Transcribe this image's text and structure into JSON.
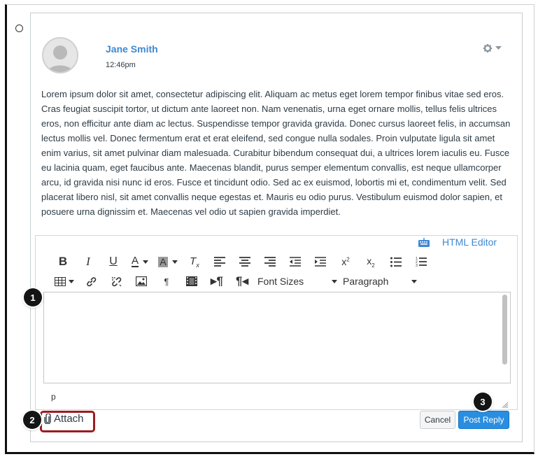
{
  "post": {
    "author": "Jane Smith",
    "time": "12:46pm",
    "body": "Lorem ipsum dolor sit amet, consectetur adipiscing elit. Aliquam ac metus eget lorem tempor finibus vitae sed eros. Cras feugiat suscipit tortor, ut dictum ante laoreet non. Nam venenatis, urna eget ornare mollis, tellus felis ultrices eros, non efficitur ante diam ac lectus. Suspendisse tempor gravida gravida. Donec cursus laoreet felis, in accumsan lectus mollis vel. Donec fermentum erat et erat eleifend, sed congue nulla sodales. Proin vulputate ligula sit amet enim varius, sit amet pulvinar diam malesuada. Curabitur bibendum consequat dui, a ultrices lorem iaculis eu. Fusce eu lacinia quam, eget faucibus ante. Maecenas blandit, purus semper elementum convallis, est neque ullamcorper arcu, id gravida nisi nunc id eros. Fusce et tincidunt odio. Sed ac ex euismod, lobortis mi et, condimentum velit. Sed placerat libero nisl, sit amet convallis neque egestas et. Mauris eu odio purus. Vestibulum euismod dolor sapien, et posuere urna dignissim et. Maecenas vel odio ut sapien gravida imperdiet."
  },
  "editor": {
    "html_editor_label": "HTML Editor",
    "font_sizes_label": "Font Sizes",
    "paragraph_label": "Paragraph",
    "content": "",
    "path": "p"
  },
  "actions": {
    "attach_label": "Attach",
    "cancel_label": "Cancel",
    "post_label": "Post Reply"
  },
  "callouts": [
    "1",
    "2",
    "3"
  ],
  "colors": {
    "link": "#3e88d1",
    "primary": "#2a8ee0",
    "highlight": "#9b1c20",
    "text": "#2d3b45"
  },
  "icons": {
    "toolbar_row1": [
      "bold-icon",
      "italic-icon",
      "underline-icon",
      "text-color-icon",
      "background-color-icon",
      "clear-formatting-icon",
      "align-left-icon",
      "align-center-icon",
      "align-right-icon",
      "outdent-icon",
      "indent-icon",
      "superscript-icon",
      "subscript-icon",
      "bullet-list-icon",
      "numbered-list-icon"
    ],
    "toolbar_row2": [
      "table-icon",
      "link-icon",
      "unlink-icon",
      "image-icon",
      "paragraph-icon",
      "media-icon",
      "ltr-icon",
      "rtl-icon"
    ]
  }
}
